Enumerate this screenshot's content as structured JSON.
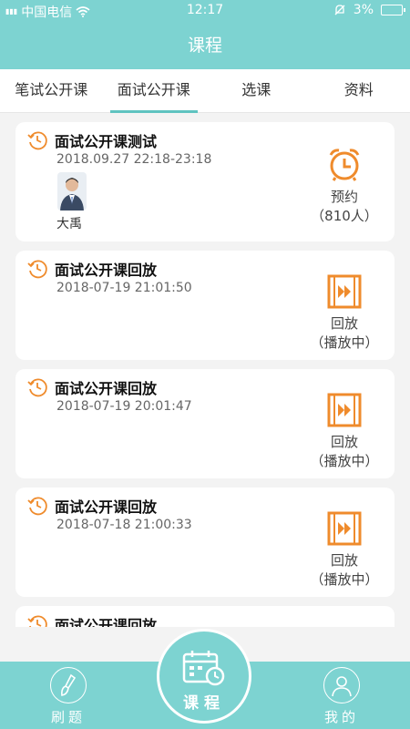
{
  "status": {
    "signal_small": "26/20",
    "carrier": "中国电信",
    "time": "12:17",
    "battery": "3%"
  },
  "header": {
    "title": "课程"
  },
  "tabs": [
    {
      "label": "笔试公开课"
    },
    {
      "label": "面试公开课"
    },
    {
      "label": "选课"
    },
    {
      "label": "资料"
    }
  ],
  "courses": [
    {
      "title": "面试公开课测试",
      "time": "2018.09.27 22:18-23:18",
      "teacher": "大禹",
      "action_l1": "预约",
      "action_l2": "（810人）"
    },
    {
      "title": "面试公开课回放",
      "time": "2018-07-19 21:01:50",
      "action_l1": "回放",
      "action_l2": "（播放中）"
    },
    {
      "title": "面试公开课回放",
      "time": "2018-07-19 20:01:47",
      "action_l1": "回放",
      "action_l2": "（播放中）"
    },
    {
      "title": "面试公开课回放",
      "time": "2018-07-18 21:00:33",
      "action_l1": "回放",
      "action_l2": "（播放中）"
    },
    {
      "title": "面试公开课回放"
    }
  ],
  "bottom_nav": {
    "left": "刷题",
    "center": "课程",
    "right": "我的"
  },
  "colors": {
    "teal": "#7dd3d1",
    "orange": "#ef8b2c"
  }
}
